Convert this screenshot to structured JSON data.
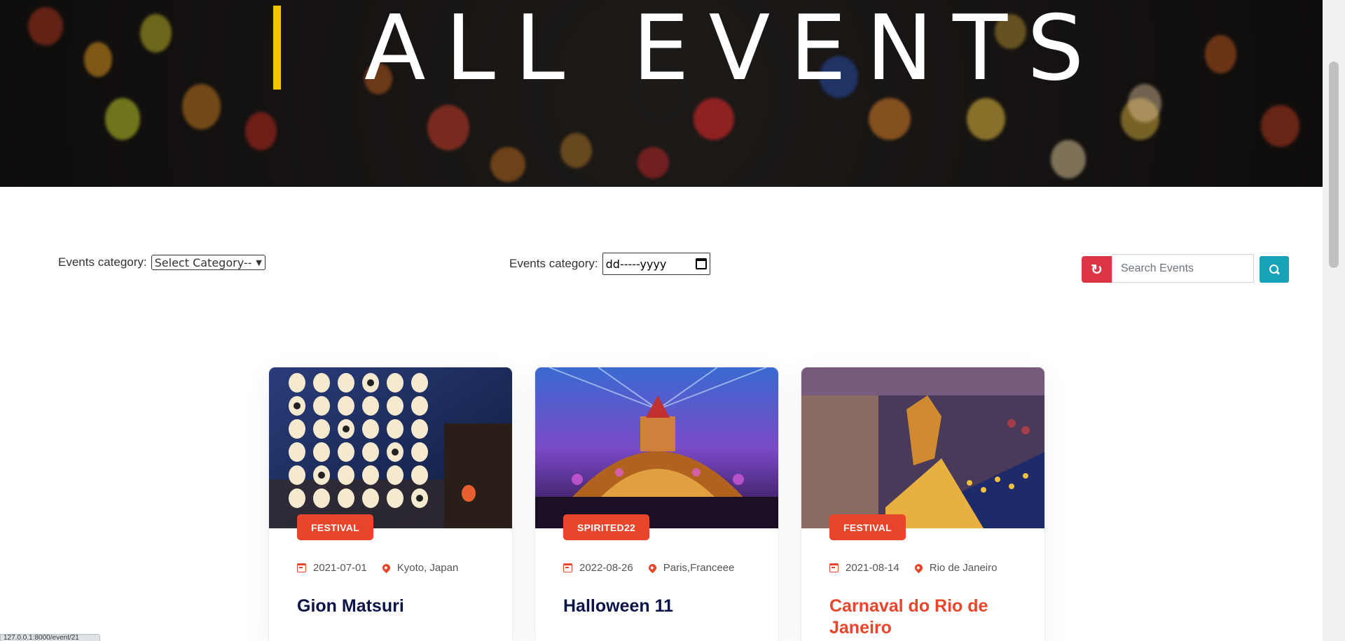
{
  "hero": {
    "title": "ALL EVENTS"
  },
  "filters": {
    "category_label": "Events category:",
    "category_selected": "Select Category--",
    "date_label": "Events category:",
    "date_value": "dd-----yyyy"
  },
  "search": {
    "placeholder": "Search Events"
  },
  "events": [
    {
      "badge": "FESTIVAL",
      "date": "2021-07-01",
      "location": "Kyoto, Japan",
      "title": "Gion Matsuri"
    },
    {
      "badge": "SPIRITED22",
      "date": "2022-08-26",
      "location": "Paris,Franceee",
      "title": "Halloween 11"
    },
    {
      "badge": "FESTIVAL",
      "date": "2021-08-14",
      "location": "Rio de Janeiro",
      "title": "Carnaval do Rio de Janeiro"
    }
  ],
  "colors": {
    "accent": "#e8452a",
    "reset": "#dc3545",
    "search": "#17a2b8",
    "title": "#0b1448",
    "hero_bar": "#f5c400"
  },
  "icons": {
    "reset": "refresh-icon",
    "search": "search-icon",
    "date": "calendar-icon",
    "location": "map-marker-icon"
  },
  "status_bar": {
    "url": "127.0.0.1:8000/event/21"
  }
}
